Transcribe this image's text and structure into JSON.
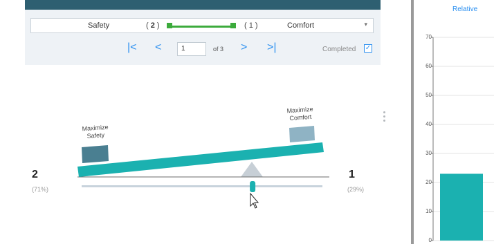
{
  "header": {
    "criteria_left": "Safety",
    "criteria_right": "Comfort",
    "weight_left": "2",
    "weight_right": "1",
    "caret_icon": "chevron-down-icon",
    "accent_color": "#3cab3c"
  },
  "pager": {
    "current_page": "1",
    "of_label": "of 3",
    "first_icon": "first-page-icon",
    "prev_icon": "previous-page-icon",
    "next_icon": "next-page-icon",
    "last_icon": "last-page-icon",
    "completed_label": "Completed",
    "completed_checked": true
  },
  "scale": {
    "left_label_line1": "Maximize",
    "left_label_line2": "Safety",
    "right_label_line1": "Maximize",
    "right_label_line2": "Comfort",
    "left_value": "2",
    "left_pct": "(71%)",
    "right_value": "1",
    "right_pct": "(29%)",
    "slider_fraction": 0.71,
    "beam_color": "#1bb1b0",
    "left_weight_color": "#4a7f91",
    "right_weight_color": "#8fb3c4"
  },
  "chart": {
    "title": "Relative",
    "bar_color": "#1bb1b0"
  },
  "chart_data": {
    "type": "bar",
    "title": "Relative",
    "ylim": [
      0,
      70
    ],
    "yticks": [
      "0",
      "10",
      "20",
      "30",
      "40",
      "50",
      "60",
      "70"
    ],
    "series": [
      {
        "values": [
          23
        ]
      }
    ],
    "grid": true
  }
}
